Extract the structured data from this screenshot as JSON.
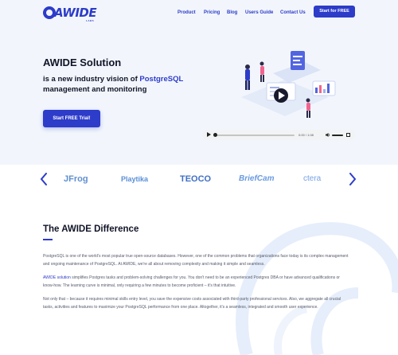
{
  "header": {
    "logo_text": "AWIDE",
    "logo_sub": "LABS",
    "nav": [
      "Product",
      "Pricing",
      "Blog",
      "Users Guide",
      "Contact Us"
    ],
    "cta_label": "Start for FREE"
  },
  "hero": {
    "title": "AWIDE Solution",
    "subtitle_pre": "is a new industry vision of ",
    "subtitle_highlight": "PostgreSQL",
    "subtitle_post": " management and monitoring",
    "trial_button": "Start FREE Trial!",
    "video": {
      "time": "0:00 / 1:08",
      "playing": false,
      "volume_level": 1.0
    }
  },
  "clients": {
    "logos": [
      "JFrog",
      "Playtika",
      "TEOCO",
      "BriefCam",
      "ctera"
    ],
    "prev_icon": "chevron-left-icon",
    "next_icon": "chevron-right-icon"
  },
  "difference": {
    "title": "The AWIDE Difference",
    "p1": "PostgreSQL is one of the world's most popular true open-source databases. However, one of the common problems that organizations face today is its complex management and ongoing maintenance of PostgreSQL. At AWIDE, we're all about removing complexity and making it simple and seamless.",
    "p2_link": "AWIDE solution",
    "p2_rest": " simplifies Postgres tasks and problem-solving challenges for you. You don't need to be an experienced Postgres DBA or have advanced qualifications or know-how. The learning curve is minimal, only requiring a few minutes to become proficient – it's that intuitive.",
    "p3": "Not only that – because it requires minimal skills entry level, you save the expensive costs associated with third-party professional services. Also, we aggregate all crucial tasks, activities and features to maximize your PostgreSQL performance from one place. Altogether, it's a seamless, integrated and smooth user experience."
  },
  "colors": {
    "brand": "#2d3cc9",
    "hero_bg": "#f2f6fc",
    "text": "#111427",
    "body_text": "#555a6b"
  }
}
